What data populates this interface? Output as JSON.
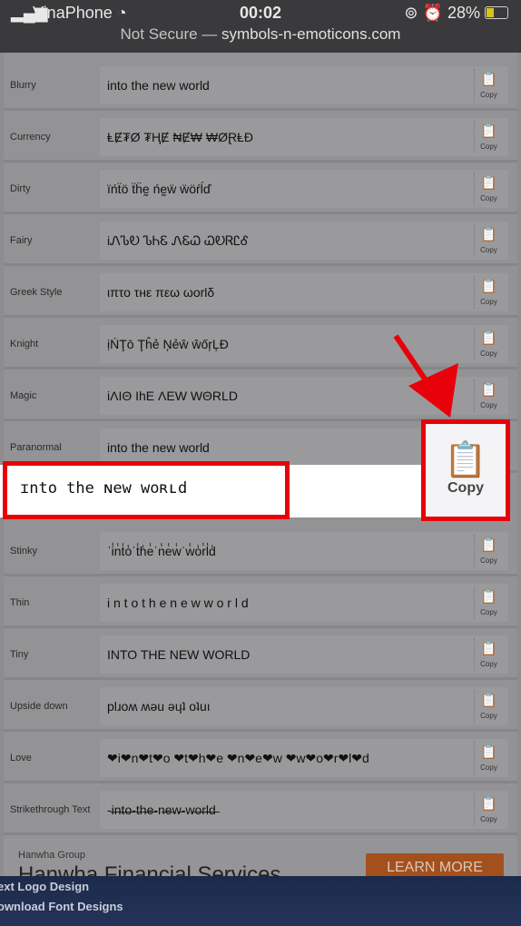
{
  "status": {
    "carrier": "VinaPhone",
    "time": "00:02",
    "battery": "28%",
    "url_prefix": "Not Secure —",
    "url": "symbols-n-emoticons.com"
  },
  "rows": [
    {
      "label": "Blurry",
      "value": "into the new world"
    },
    {
      "label": "Currency",
      "value": "ⱠɆ₮Ø ₮ⱧɆ ₦Ɇ₩ ₩ØⱤⱠĐ"
    },
    {
      "label": "Dirty",
      "value": "ïńẗö ẗḧḛ ńḛẅ ẅöŕĺď"
    },
    {
      "label": "Fairy",
      "value": "iᏁᏖᎧ ᏖᏂᏋ ᏁᏋᏇ ᏇᎧᏒᏝᎴ"
    },
    {
      "label": "Greek Style",
      "value": "ιπτο τнε πεω ωorlδ"
    },
    {
      "label": "Knight",
      "value": "ịŃŢō Ţĥẻ Ņẻŵ ŵőŗĻĐ"
    },
    {
      "label": "Magic",
      "value": "iΛIΘ IhE ΛEW WΘRLD"
    },
    {
      "label": "Paranormal",
      "value": "into the new world"
    },
    {
      "label": "",
      "value": ""
    },
    {
      "label": "Stinky",
      "value": "ˈi̾n̾t̾o̾ˈt̾h̾e̾ˈn̾e̾w̾ˈw̾o̾r̾l̾d̾"
    },
    {
      "label": "Thin",
      "value": "i n t o   t h e   n e w   w o r l d"
    },
    {
      "label": "Tiny",
      "value": "INTO THE NEW WORLD"
    },
    {
      "label": "Upside down",
      "value": "plɹoʍ ʍǝu ǝɥʇ oʇuı"
    },
    {
      "label": "Love",
      "value": "❤i❤n❤t❤o ❤t❤h❤e ❤n❤e❤w ❤w❤o❤r❤l❤d"
    },
    {
      "label": "Strikethrough Text",
      "value": "-i̶n̶t̶o̶-t̶h̶e̶-n̶e̶w̶-w̶o̶r̶l̶d̶"
    }
  ],
  "copy_label": "Copy",
  "highlight": {
    "value": "ɪnto the ɴew woʀʟd",
    "copy_label": "Copy"
  },
  "ad": {
    "sponsor": "Hanwha Group",
    "headline": "Hanwha Financial Services",
    "button": "LEARN MORE"
  },
  "nav": [
    "ext Logo Design",
    "ownload Font Designs"
  ],
  "colors": {
    "highlight": "#e8000a",
    "ad_button": "#a4501c",
    "nav": "#1c2a4a"
  }
}
